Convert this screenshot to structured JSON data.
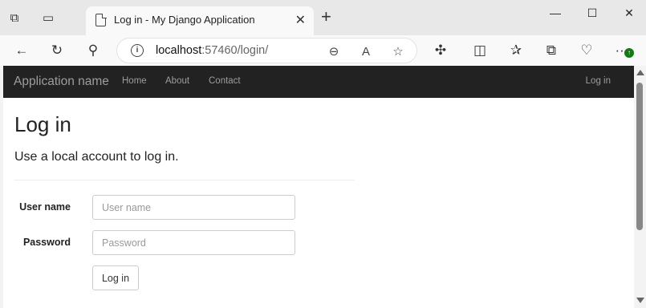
{
  "browser": {
    "tab_title": "Log in - My Django Application",
    "tab_close": "✕",
    "new_tab": "+",
    "url_host": "localhost",
    "url_rest": ":57460/login/",
    "window_controls": {
      "minimize": "—",
      "maximize": "☐",
      "close": "✕"
    },
    "more_menu": "···"
  },
  "navbar": {
    "brand": "Application name",
    "links": [
      "Home",
      "About",
      "Contact"
    ],
    "login_link": "Log in"
  },
  "page": {
    "title": "Log in",
    "subtitle": "Use a local account to log in.",
    "form": {
      "username_label": "User name",
      "username_placeholder": "User name",
      "password_label": "Password",
      "password_placeholder": "Password",
      "submit_label": "Log in"
    }
  },
  "colors": {
    "navbar_bg": "#222222",
    "navbar_text": "#9d9d9d",
    "status_green": "#107c10"
  }
}
